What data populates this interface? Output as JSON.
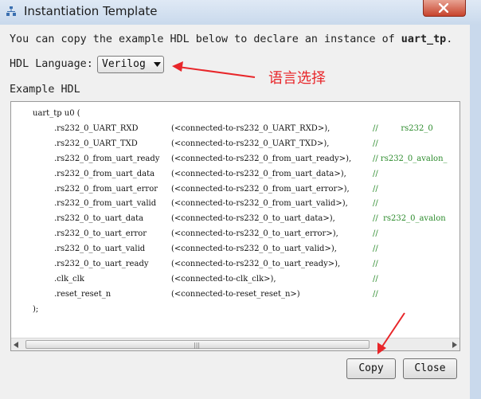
{
  "window": {
    "title": "Instantiation Template",
    "close_icon": "close-x-icon",
    "app_icon": "network-icon"
  },
  "intro": {
    "prefix": "You can copy the example HDL below to declare an instance of ",
    "instance": "uart_tp",
    "suffix": "."
  },
  "hdl_language": {
    "label": "HDL Language:",
    "selected": "Verilog"
  },
  "example": {
    "label": "Example HDL",
    "lines": [
      {
        "signal": "uart_tp u0 (",
        "conn": "",
        "comment": ""
      },
      {
        "signal": ".rs232_0_UART_RXD",
        "conn": "(<connected-to-rs232_0_UART_RXD>),",
        "comment": "//         rs232_0"
      },
      {
        "signal": ".rs232_0_UART_TXD",
        "conn": "(<connected-to-rs232_0_UART_TXD>),",
        "comment": "//"
      },
      {
        "signal": ".rs232_0_from_uart_ready",
        "conn": "(<connected-to-rs232_0_from_uart_ready>),",
        "comment": "// rs232_0_avalon_"
      },
      {
        "signal": ".rs232_0_from_uart_data",
        "conn": "(<connected-to-rs232_0_from_uart_data>),",
        "comment": "//"
      },
      {
        "signal": ".rs232_0_from_uart_error",
        "conn": "(<connected-to-rs232_0_from_uart_error>),",
        "comment": "//"
      },
      {
        "signal": ".rs232_0_from_uart_valid",
        "conn": "(<connected-to-rs232_0_from_uart_valid>),",
        "comment": "//"
      },
      {
        "signal": ".rs232_0_to_uart_data",
        "conn": "(<connected-to-rs232_0_to_uart_data>),",
        "comment": "//  rs232_0_avalon"
      },
      {
        "signal": ".rs232_0_to_uart_error",
        "conn": "(<connected-to-rs232_0_to_uart_error>),",
        "comment": "//"
      },
      {
        "signal": ".rs232_0_to_uart_valid",
        "conn": "(<connected-to-rs232_0_to_uart_valid>),",
        "comment": "//"
      },
      {
        "signal": ".rs232_0_to_uart_ready",
        "conn": "(<connected-to-rs232_0_to_uart_ready>),",
        "comment": "//"
      },
      {
        "signal": ".clk_clk",
        "conn": "(<connected-to-clk_clk>),",
        "comment": "//"
      },
      {
        "signal": ".reset_reset_n",
        "conn": "(<connected-to-reset_reset_n>)",
        "comment": "//"
      },
      {
        "signal": ");",
        "conn": "",
        "comment": ""
      }
    ]
  },
  "buttons": {
    "copy": "Copy",
    "close": "Close"
  },
  "annotation": {
    "text": "语言选择",
    "color": "#e8262a"
  },
  "colors": {
    "comment": "#2a8a2a",
    "titlebar": "#dfe9f5"
  }
}
